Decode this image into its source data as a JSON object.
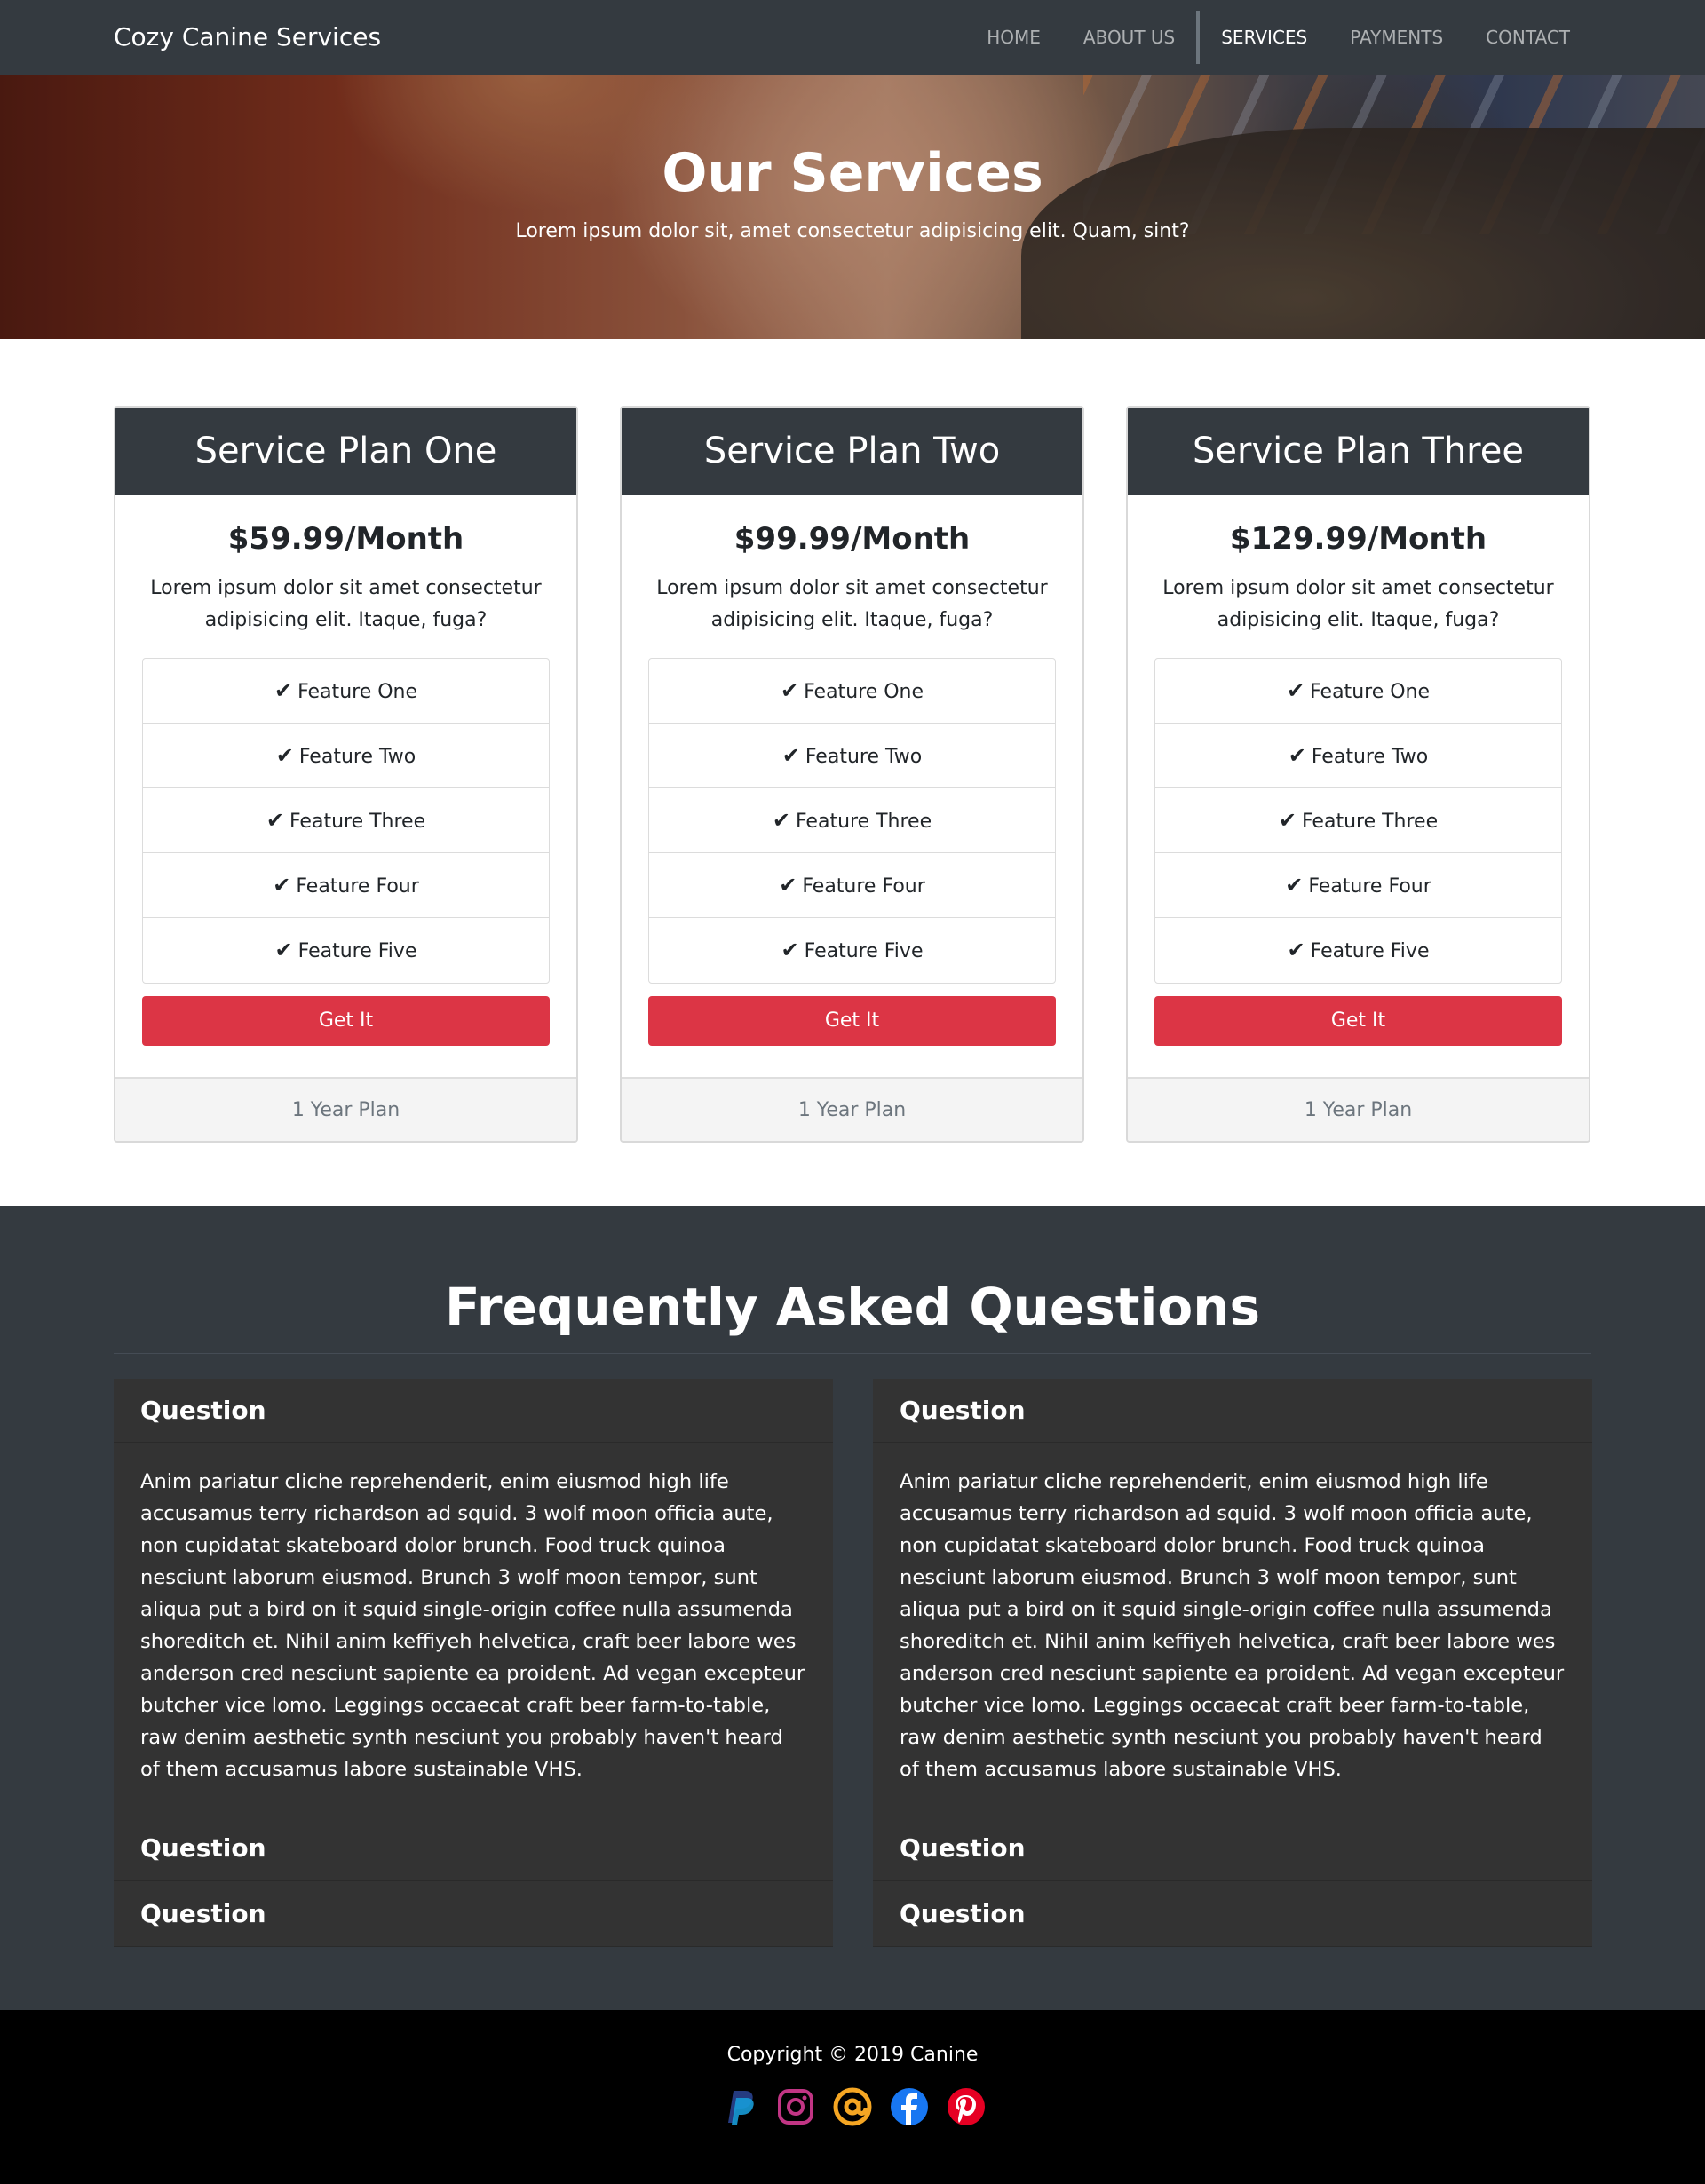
{
  "nav": {
    "brand": "Cozy Canine Services",
    "items": [
      "HOME",
      "ABOUT US",
      "SERVICES",
      "PAYMENTS",
      "CONTACT"
    ],
    "active": "SERVICES"
  },
  "hero": {
    "title": "Our Services",
    "subtitle": "Lorem ipsum dolor sit, amet consectetur adipisicing elit. Quam, sint?"
  },
  "plans": [
    {
      "title": "Service Plan One",
      "price": "$59.99/Month",
      "description": "Lorem ipsum dolor sit amet consectetur adipisicing elit. Itaque, fuga?",
      "features": [
        "Feature One",
        "Feature Two",
        "Feature Three",
        "Feature Four",
        "Feature Five"
      ],
      "button": "Get It",
      "footer": "1 Year Plan"
    },
    {
      "title": "Service Plan Two",
      "price": "$99.99/Month",
      "description": "Lorem ipsum dolor sit amet consectetur adipisicing elit. Itaque, fuga?",
      "features": [
        "Feature One",
        "Feature Two",
        "Feature Three",
        "Feature Four",
        "Feature Five"
      ],
      "button": "Get It",
      "footer": "1 Year Plan"
    },
    {
      "title": "Service Plan Three",
      "price": "$129.99/Month",
      "description": "Lorem ipsum dolor sit amet consectetur adipisicing elit. Itaque, fuga?",
      "features": [
        "Feature One",
        "Feature Two",
        "Feature Three",
        "Feature Four",
        "Feature Five"
      ],
      "button": "Get It",
      "footer": "1 Year Plan"
    }
  ],
  "faq": {
    "title": "Frequently Asked Questions",
    "columns": [
      {
        "items": [
          {
            "question": "Question",
            "answer": "Anim pariatur cliche reprehenderit, enim eiusmod high life accusamus terry richardson ad squid. 3 wolf moon officia aute, non cupidatat skateboard dolor brunch. Food truck quinoa nesciunt laborum eiusmod. Brunch 3 wolf moon tempor, sunt aliqua put a bird on it squid single-origin coffee nulla assumenda shoreditch et. Nihil anim keffiyeh helvetica, craft beer labore wes anderson cred nesciunt sapiente ea proident. Ad vegan excepteur butcher vice lomo. Leggings occaecat craft beer farm-to-table, raw denim aesthetic synth nesciunt you probably haven't heard of them accusamus labore sustainable VHS."
          },
          {
            "question": "Question"
          },
          {
            "question": "Question"
          }
        ]
      },
      {
        "items": [
          {
            "question": "Question",
            "answer": "Anim pariatur cliche reprehenderit, enim eiusmod high life accusamus terry richardson ad squid. 3 wolf moon officia aute, non cupidatat skateboard dolor brunch. Food truck quinoa nesciunt laborum eiusmod. Brunch 3 wolf moon tempor, sunt aliqua put a bird on it squid single-origin coffee nulla assumenda shoreditch et. Nihil anim keffiyeh helvetica, craft beer labore wes anderson cred nesciunt sapiente ea proident. Ad vegan excepteur butcher vice lomo. Leggings occaecat craft beer farm-to-table, raw denim aesthetic synth nesciunt you probably haven't heard of them accusamus labore sustainable VHS."
          },
          {
            "question": "Question"
          },
          {
            "question": "Question"
          }
        ]
      }
    ]
  },
  "footer": {
    "copyright": "Copyright © 2019 Canine",
    "socials": [
      {
        "icon": "paypal-icon",
        "color": "#253b80"
      },
      {
        "icon": "instagram-icon",
        "color": "#c13584"
      },
      {
        "icon": "at-sign-icon",
        "color": "#f5a623"
      },
      {
        "icon": "facebook-icon",
        "color": "#1877f2"
      },
      {
        "icon": "pinterest-icon",
        "color": "#e60023"
      }
    ]
  },
  "colors": {
    "navbar": "#343a40",
    "accent_button": "#dc3545",
    "faq_panel": "#333333",
    "footer": "#000000"
  }
}
